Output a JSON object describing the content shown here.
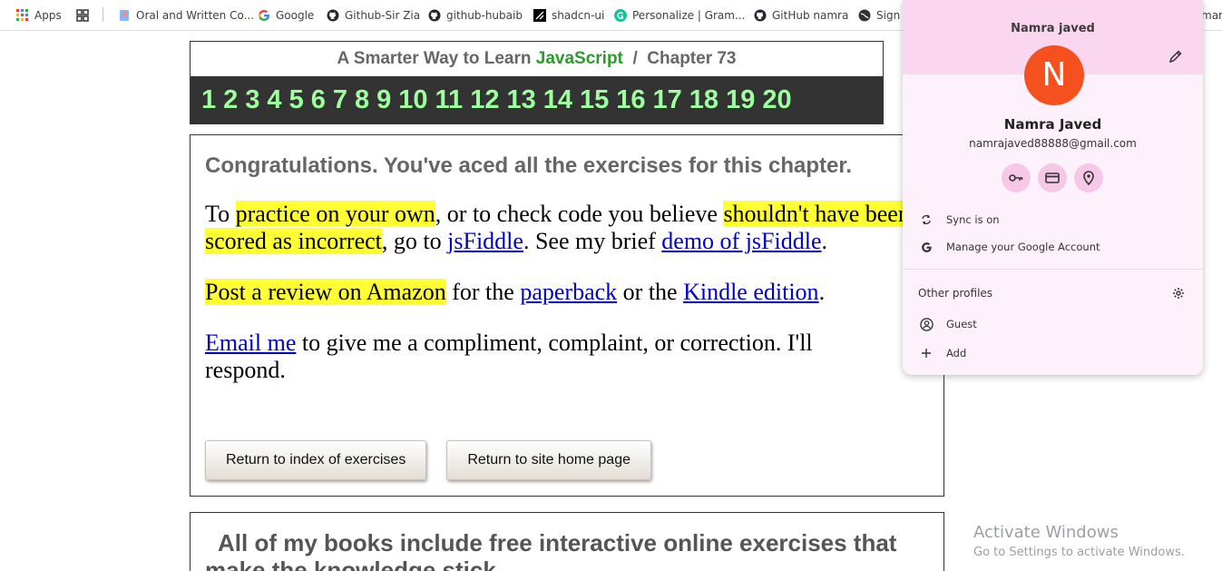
{
  "bookmarks": [
    {
      "label": "Apps",
      "icon": "apps-grid-icon"
    },
    {
      "label": "",
      "icon": "tab-grid-icon"
    },
    {
      "label": "Oral and Written Co...",
      "icon": "doc-icon"
    },
    {
      "label": "Google",
      "icon": "google-icon"
    },
    {
      "label": "Github-Sir Zia",
      "icon": "github-icon"
    },
    {
      "label": "github-hubaib",
      "icon": "github-icon"
    },
    {
      "label": "shadcn-ui",
      "icon": "shadcn-icon"
    },
    {
      "label": "Personalize | Gram...",
      "icon": "grammarly-icon"
    },
    {
      "label": "GitHub namra",
      "icon": "github-icon"
    },
    {
      "label": "Sign i",
      "icon": "globe-icon"
    },
    {
      "label": "mark",
      "icon": ""
    }
  ],
  "chapter": {
    "title_prefix": "A Smarter Way to Learn",
    "title_js": "JavaScript",
    "title_sep": "/",
    "title_chapter": "Chapter 73",
    "numbers": [
      "1",
      "2",
      "3",
      "4",
      "5",
      "6",
      "7",
      "8",
      "9",
      "10",
      "11",
      "12",
      "13",
      "14",
      "15",
      "16",
      "17",
      "18",
      "19",
      "20"
    ]
  },
  "content": {
    "congrats": "Congratulations. You've aced all the exercises for this chapter.",
    "p1": {
      "t1": "To ",
      "h1": "practice on your own",
      "t2": ", or to check code you believe ",
      "h2": "shouldn't have been scored as incorrect",
      "t3": ", go to ",
      "l1": "jsFiddle",
      "t4": ". See my brief ",
      "l2": "demo of jsFiddle",
      "t5": "."
    },
    "p2": {
      "h1": "Post a review on Amazon",
      "t1": " for the ",
      "l1": "paperback",
      "t2": " or the ",
      "l2": "Kindle edition",
      "t3": "."
    },
    "p3": {
      "l1": "Email me",
      "t1": " to give me a compliment, complaint, or correction. I'll respond."
    },
    "buttons": {
      "index": "Return to index of exercises",
      "home": "Return to site home page"
    }
  },
  "bottom": {
    "text": "All of my books include free interactive online exercises that make the knowledge stick."
  },
  "watermark": {
    "line1": "Activate Windows",
    "line2": "Go to Settings to activate Windows."
  },
  "profile": {
    "header_name": "Namra javed",
    "avatar_letter": "N",
    "full_name": "Namra Javed",
    "email": "namrajaved88888@gmail.com",
    "sync": "Sync is on",
    "manage": "Manage your Google Account",
    "other_profiles": "Other profiles",
    "guest": "Guest",
    "add": "Add",
    "colors": {
      "header": "#fbd6ef",
      "avatar": "#f4511e",
      "panel": "#fdf2fb"
    }
  }
}
